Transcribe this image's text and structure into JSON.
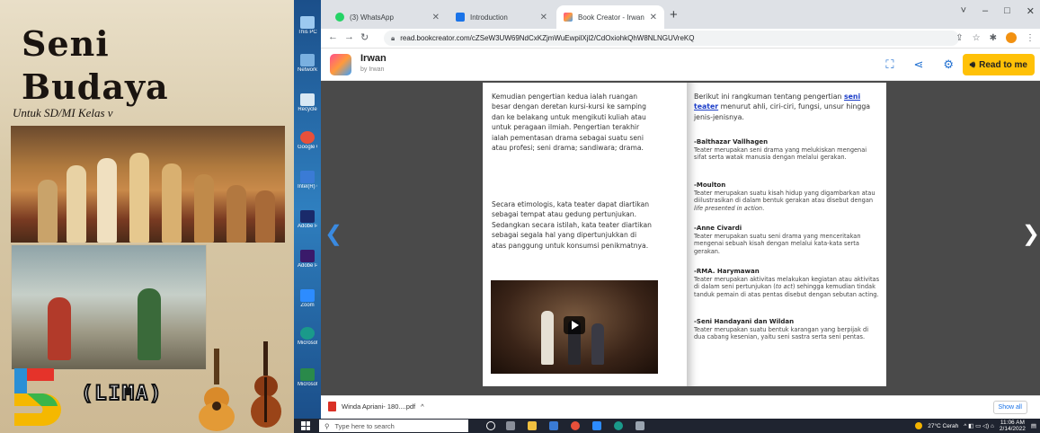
{
  "cover": {
    "title_line1": "Seni",
    "title_line2": "Budaya",
    "subtitle": "Untuk SD/MI Kelas v",
    "grade_word": "(LIMA)"
  },
  "desktop_icons": [
    "This PC",
    "Network",
    "Recycle",
    "Google Chrome",
    "Intel(R) Graphics",
    "Adobe Photosh",
    "Adobe Premiere",
    "Zoom",
    "Microsoft Edge",
    "Microsoft Excel 2010"
  ],
  "browser": {
    "tabs": [
      {
        "label": "(3) WhatsApp",
        "color": "#25d366"
      },
      {
        "label": "Introduction",
        "color": "#1a73e8"
      },
      {
        "label": "Book Creator - Irwan",
        "color": "#ff7a3c"
      }
    ],
    "new_tab": "+",
    "url": "read.bookcreator.com/cZSeW3UW69NdCxKZjmWuEwpilXjl2/CdOxiohkQhW8NLNGUVreKQ",
    "window_controls": [
      "˅",
      "–",
      "□",
      "✕"
    ]
  },
  "app": {
    "owner": "Irwan",
    "by": "by Irwan",
    "read_to_me": "Read to me"
  },
  "book": {
    "left_para1": "Kemudian pengertian kedua ialah ruangan besar dengan deretan kursi-kursi ke samping dan ke belakang untuk mengikuti kuliah atau untuk peragaan ilmiah. Pengertian terakhir ialah pementasan drama sebagai suatu seni atau profesi; seni drama; sandiwara; drama.",
    "left_para2": "Secara etimologis, kata teater dapat diartikan sebagai tempat atau gedung pertunjukan. Sedangkan secara istilah, kata teater diartikan sebagai segala hal yang dipertunjukkan di atas panggung untuk konsumsi penikmatnya.",
    "right_intro_a": "Berikut ini rangkuman tentang pengertian ",
    "right_intro_link": "seni teater",
    "right_intro_b": " menurut ahli, ciri-ciri, fungsi, unsur hingga jenis-jenisnya.",
    "entries": [
      {
        "name": "-Balthazar Vallhagen",
        "text": "Teater merupakan seni drama yang melukiskan mengenai sifat serta watak manusia dengan melalui gerakan."
      },
      {
        "name": "-Moulton",
        "text": "Teater merupakan suatu kisah hidup yang digambarkan atau diilustrasikan di dalam bentuk gerakan atau disebut dengan ",
        "italic": "life presented in action",
        "tail": "."
      },
      {
        "name": "-Anne Civardi",
        "text": "Teater merupakan suatu seni drama yang menceritakan mengenai sebuah kisah dengan melalui kata-kata serta gerakan."
      },
      {
        "name": "-RMA. Harymawan",
        "text": "Teater merupakan aktivitas melakukan kegiatan atau aktivitas di dalam seni pertunjukan (",
        "italic": "to act",
        "tail": ") sehingga kemudian tindak tanduk pemain di atas pentas disebut dengan sebutan acting."
      },
      {
        "name": "-Seni Handayani dan Wildan",
        "text": "Teater merupakan suatu bentuk karangan yang berpijak di dua cabang kesenian, yaitu seni sastra serta seni pentas."
      }
    ]
  },
  "downloads": {
    "file": "Winda Apriani- 180....pdf",
    "show_all": "Show all"
  },
  "taskbar": {
    "search_placeholder": "Type here to search",
    "weather": "27°C  Cerah",
    "time": "11:06 AM",
    "date": "2/14/2022"
  }
}
